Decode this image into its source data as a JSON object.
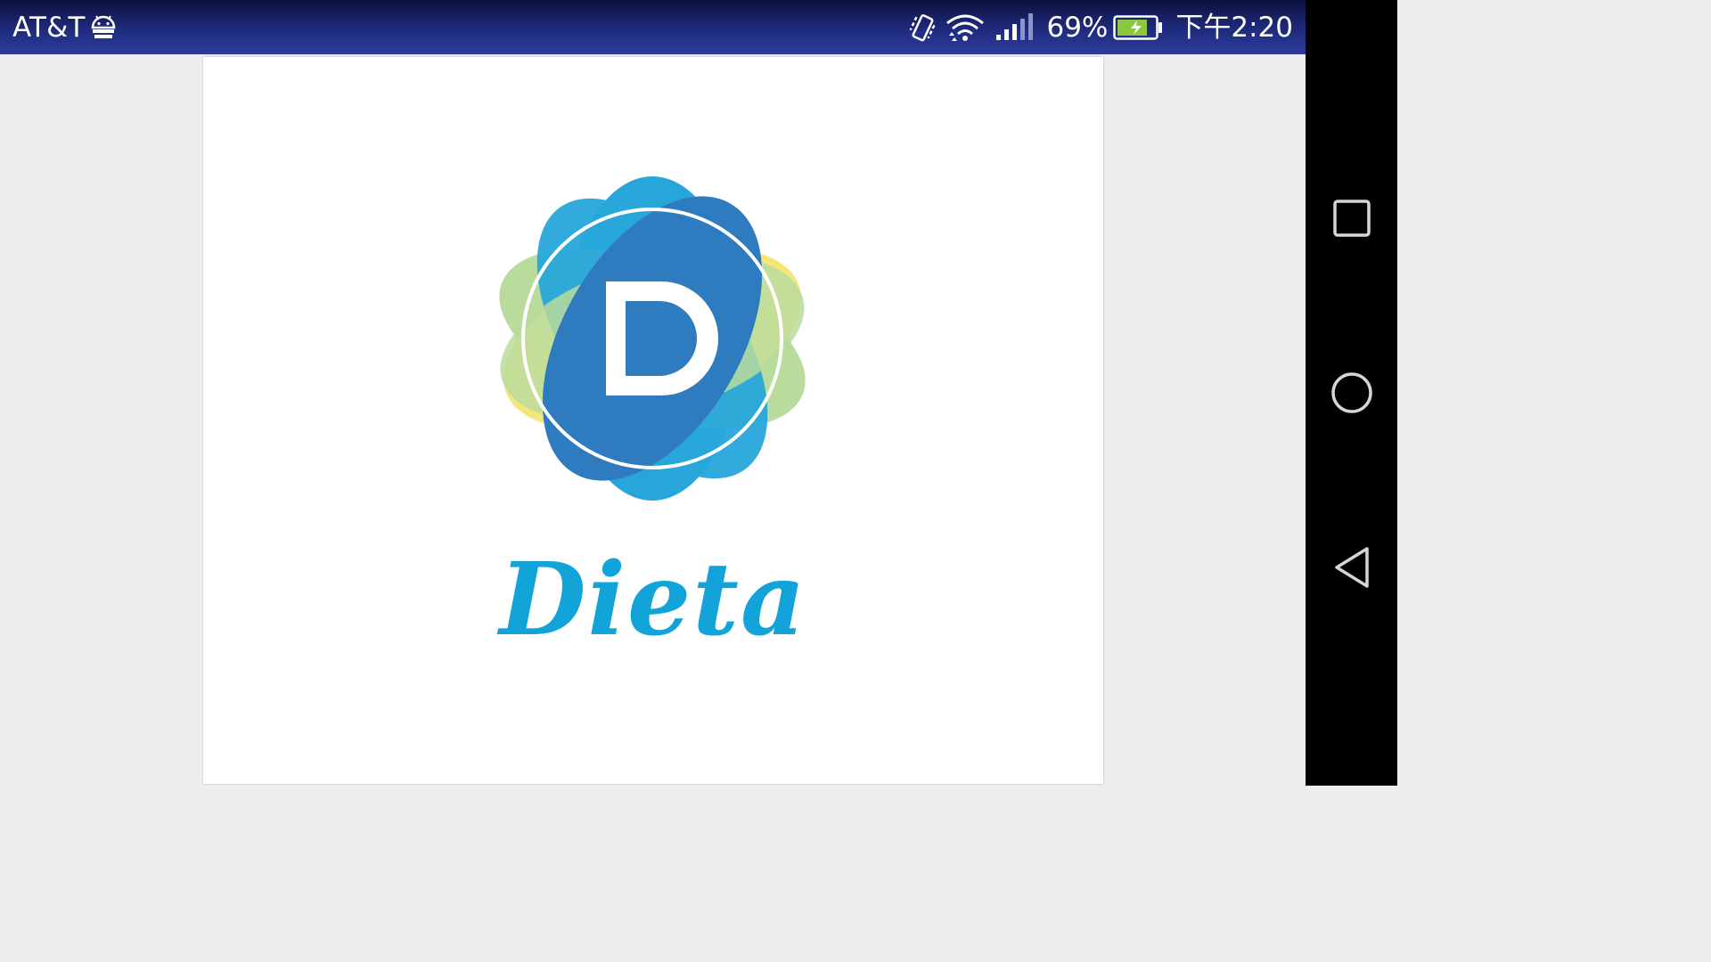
{
  "status_bar": {
    "carrier": "AT&T",
    "battery_percent": "69%",
    "time": "下午2:20",
    "icons": [
      "android-icon",
      "vibrate-icon",
      "wifi-icon",
      "signal-icon",
      "battery-charging-icon"
    ]
  },
  "splash": {
    "app_name": "Dieta",
    "logo_letter": "D",
    "colors": {
      "blue_dark": "#2f7bbf",
      "blue_light": "#27a6da",
      "orange": "#ef9466",
      "yellow": "#f5e67a",
      "green": "#b9dc9d",
      "wordmark": "#12a4d8"
    }
  },
  "nav_bar": {
    "buttons": [
      "recents-button",
      "home-button",
      "back-button"
    ]
  }
}
